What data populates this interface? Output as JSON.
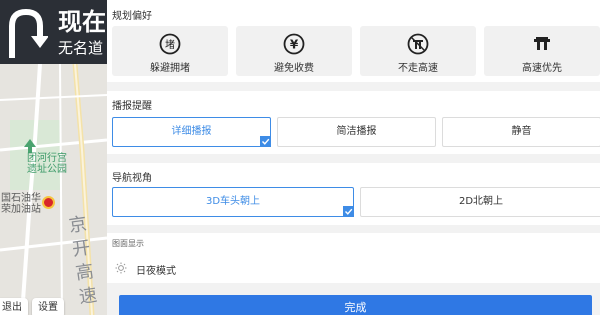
{
  "map": {
    "banner_title": "现在",
    "banner_subtitle": "无名道",
    "poi_park": "团河行宫\n遗址公园",
    "poi_gas": "国石油华\n荣加油站",
    "road_name": "京开高速",
    "exit_button": "退出",
    "settings_button": "设置"
  },
  "route_pref": {
    "title": "规划偏好",
    "options": [
      {
        "label": "躲避拥堵",
        "icon": "avoid-congestion-icon"
      },
      {
        "label": "避免收费",
        "icon": "avoid-toll-icon"
      },
      {
        "label": "不走高速",
        "icon": "no-highway-icon"
      },
      {
        "label": "高速优先",
        "icon": "highway-first-icon"
      }
    ]
  },
  "broadcast": {
    "title": "播报提醒",
    "options": [
      "详细播报",
      "简洁播报",
      "静音"
    ],
    "selected": "详细播报"
  },
  "view": {
    "title": "导航视角",
    "options": [
      "3D车头朝上",
      "2D北朝上"
    ],
    "selected": "3D车头朝上"
  },
  "display": {
    "title": "图面显示",
    "day_night_label": "日夜模式"
  },
  "done_label": "完成",
  "colors": {
    "accent": "#3e8ce6",
    "done_button": "#2f78e4",
    "banner": "#2b2f36"
  }
}
